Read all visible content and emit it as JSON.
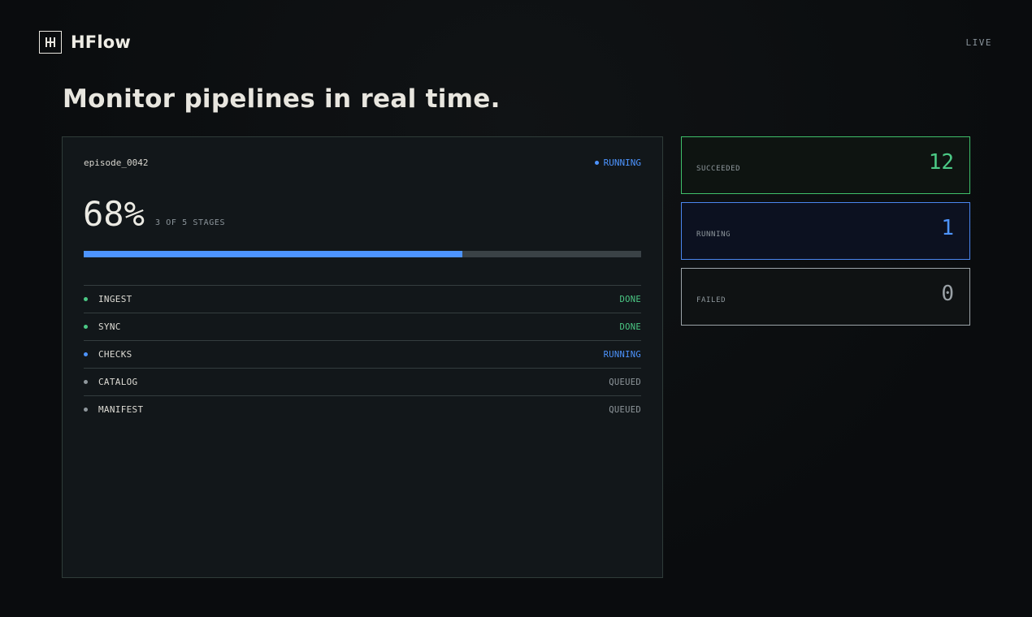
{
  "brand": {
    "name": "HFlow"
  },
  "header": {
    "live_label": "LIVE"
  },
  "headline": "Monitor pipelines in real time.",
  "episode": {
    "name": "episode_0042",
    "status": "RUNNING",
    "percent_label": "68%",
    "progress": 0.68,
    "stages_label": "3 OF 5 STAGES",
    "stages": [
      {
        "name": "INGEST",
        "state": "DONE",
        "color": "#4bc985"
      },
      {
        "name": "SYNC",
        "state": "DONE",
        "color": "#4bc985"
      },
      {
        "name": "CHECKS",
        "state": "RUNNING",
        "color": "#4d94ff"
      },
      {
        "name": "CATALOG",
        "state": "QUEUED",
        "color": "#8f979c"
      },
      {
        "name": "MANIFEST",
        "state": "QUEUED",
        "color": "#8f979c"
      }
    ]
  },
  "stats": [
    {
      "label": "SUCCEEDED",
      "value": "12",
      "color": "#4bc985",
      "border": "#3fbf6a",
      "bg": "#0e1411"
    },
    {
      "label": "RUNNING",
      "value": "1",
      "color": "#4d94ff",
      "border": "#4a86ef",
      "bg": "#0c1120"
    },
    {
      "label": "FAILED",
      "value": "0",
      "color": "#9aa1a6",
      "border": "#9ba3a8",
      "bg": "#0f1213"
    }
  ],
  "colors": {
    "accent": "#4d94ff",
    "done": "#4bc985",
    "queued": "#8f979c"
  }
}
